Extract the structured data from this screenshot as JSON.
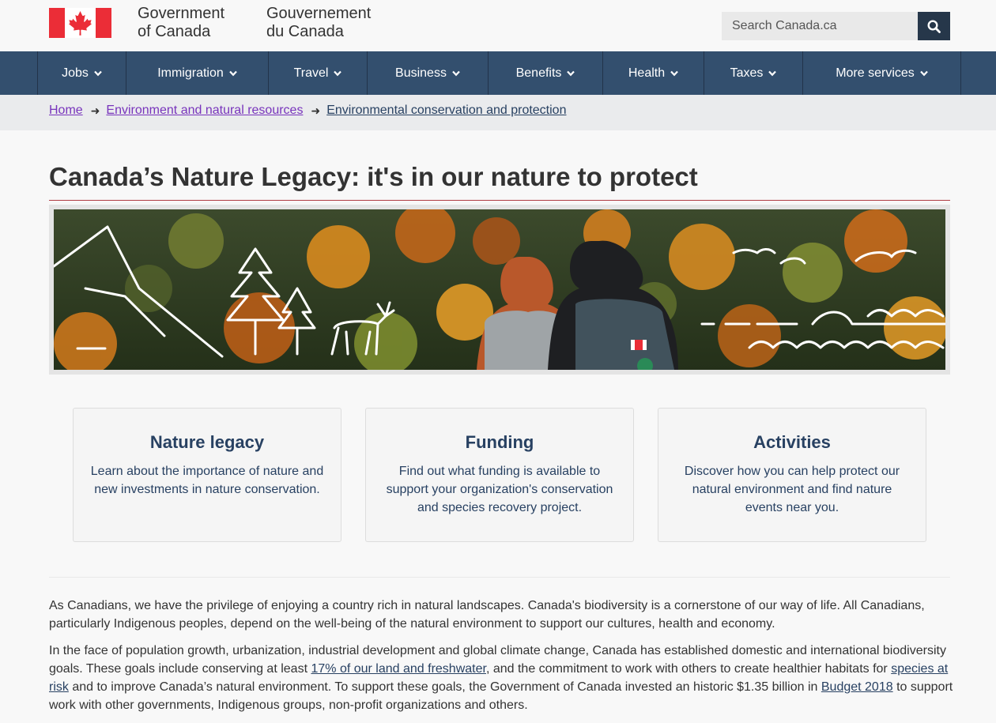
{
  "header": {
    "wordmark_en_line1": "Government",
    "wordmark_en_line2": "of Canada",
    "wordmark_fr_line1": "Gouvernement",
    "wordmark_fr_line2": "du Canada",
    "search_placeholder": "Search Canada.ca"
  },
  "menu": {
    "items": [
      {
        "label": "Jobs"
      },
      {
        "label": "Immigration"
      },
      {
        "label": "Travel"
      },
      {
        "label": "Business"
      },
      {
        "label": "Benefits"
      },
      {
        "label": "Health"
      },
      {
        "label": "Taxes"
      },
      {
        "label": "More services"
      }
    ]
  },
  "breadcrumb": {
    "items": [
      {
        "label": "Home"
      },
      {
        "label": "Environment and natural resources"
      },
      {
        "label": "Environmental conservation and protection"
      }
    ]
  },
  "page": {
    "title": "Canada’s Nature Legacy: it's in our nature to protect"
  },
  "cards": [
    {
      "title": "Nature legacy",
      "text": "Learn about the importance of nature and new investments in nature conservation."
    },
    {
      "title": "Funding",
      "text": "Find out what funding is available to support your organization's conservation and species recovery project."
    },
    {
      "title": "Activities",
      "text": "Discover how you can help protect our natural environment and find nature events near you."
    }
  ],
  "content": {
    "p1": "As Canadians, we have the privilege of enjoying a country rich in natural landscapes. Canada's biodiversity is a cornerstone of our way of life. All Canadians, particularly Indigenous peoples, depend on the well-being of the natural environment to support our cultures, health and economy.",
    "p2_a": "In the face of population growth, urbanization, industrial development and global climate change, Canada has established domestic and international biodiversity goals. These goals include conserving at least ",
    "p2_link1": "17% of our land and freshwater",
    "p2_b": ", and the commitment to work with others to create healthier habitats for ",
    "p2_link2": "species at risk",
    "p2_c": " and to improve Canada’s natural environment. To support these goals, the Government of Canada invested an historic $1.35 billion in ",
    "p2_link3": "Budget 2018",
    "p2_d": " to support work with other governments, Indigenous groups, non-profit organizations and others."
  },
  "colors": {
    "brand_red": "#eb2d37",
    "menu_bg": "#334f6e",
    "search_btn": "#26374a",
    "link": "#284162",
    "visited_link": "#7834bc",
    "title_rule": "#af3c43"
  },
  "icons": [
    "canada-flag-icon",
    "search-icon",
    "chevron-down-icon",
    "arrow-right-icon"
  ]
}
